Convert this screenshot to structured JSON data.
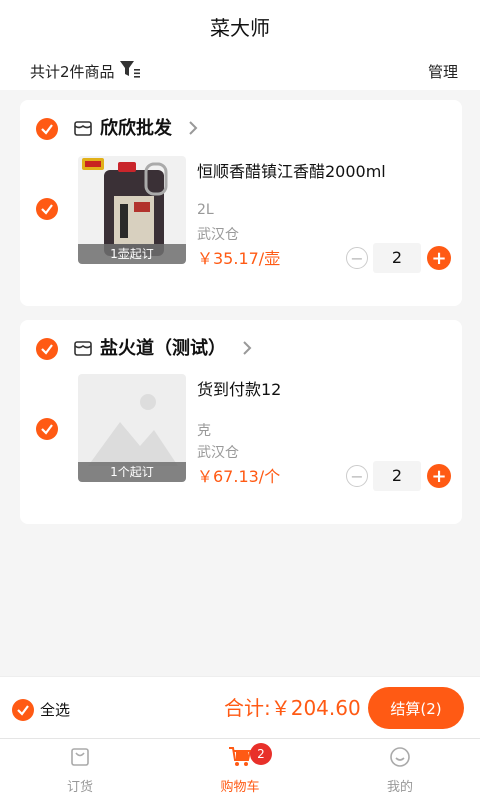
{
  "app": {
    "title": "菜大师"
  },
  "summary": {
    "count_text": "共计2件商品",
    "manage_label": "管理"
  },
  "shops": [
    {
      "name": "欣欣批发",
      "item": {
        "name": "恒顺香醋镇江香醋2000ml",
        "spec": "2L",
        "warehouse": "武汉仓",
        "price": "￥35.17/壶",
        "moq": "1壶起订",
        "quantity": "2"
      }
    },
    {
      "name": "盐火道（测试）",
      "item": {
        "name": "货到付款12",
        "spec": "克",
        "warehouse": "武汉仓",
        "price": "￥67.13/个",
        "moq": "1个起订",
        "quantity": "2"
      }
    }
  ],
  "footer": {
    "select_all_label": "全选",
    "total_text": "合计:￥204.60",
    "checkout_label": "结算(2)"
  },
  "tabbar": {
    "tabs": [
      {
        "label": "订货",
        "icon": "bag-icon"
      },
      {
        "label": "购物车",
        "icon": "cart-icon",
        "badge": "2"
      },
      {
        "label": "我的",
        "icon": "smiley-icon"
      }
    ]
  },
  "colors": {
    "accent": "#ff5a14",
    "badge": "#e8302a",
    "background": "#f5f5f5"
  }
}
